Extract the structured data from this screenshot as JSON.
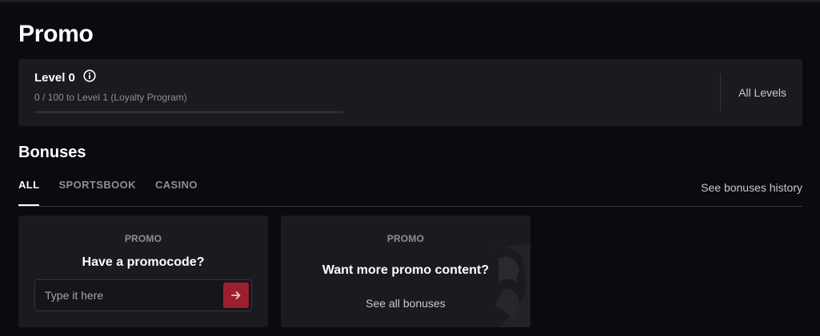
{
  "page": {
    "title": "Promo"
  },
  "loyalty": {
    "level_title": "Level 0",
    "progress_text": "0 / 100 to Level 1 (Loyalty Program)",
    "progress_fraction": 0,
    "all_levels_label": "All Levels",
    "info_icon": "info-circle-icon"
  },
  "bonuses": {
    "title": "Bonuses",
    "tabs": [
      {
        "label": "ALL",
        "active": true
      },
      {
        "label": "SPORTSBOOK",
        "active": false
      },
      {
        "label": "CASINO",
        "active": false
      }
    ],
    "history_label": "See bonuses history"
  },
  "cards": {
    "promocode": {
      "kicker": "PROMO",
      "title": "Have a promocode?",
      "input_value": "",
      "input_placeholder": "Type it here",
      "submit_icon": "arrow-right-icon"
    },
    "more": {
      "kicker": "PROMO",
      "title": "Want more promo content?",
      "link_label": "See all bonuses"
    }
  },
  "colors": {
    "background": "#0b0a0e",
    "card": "#1b1a1f",
    "accent": "#9c1f2d",
    "muted_text": "#8f8e96"
  }
}
